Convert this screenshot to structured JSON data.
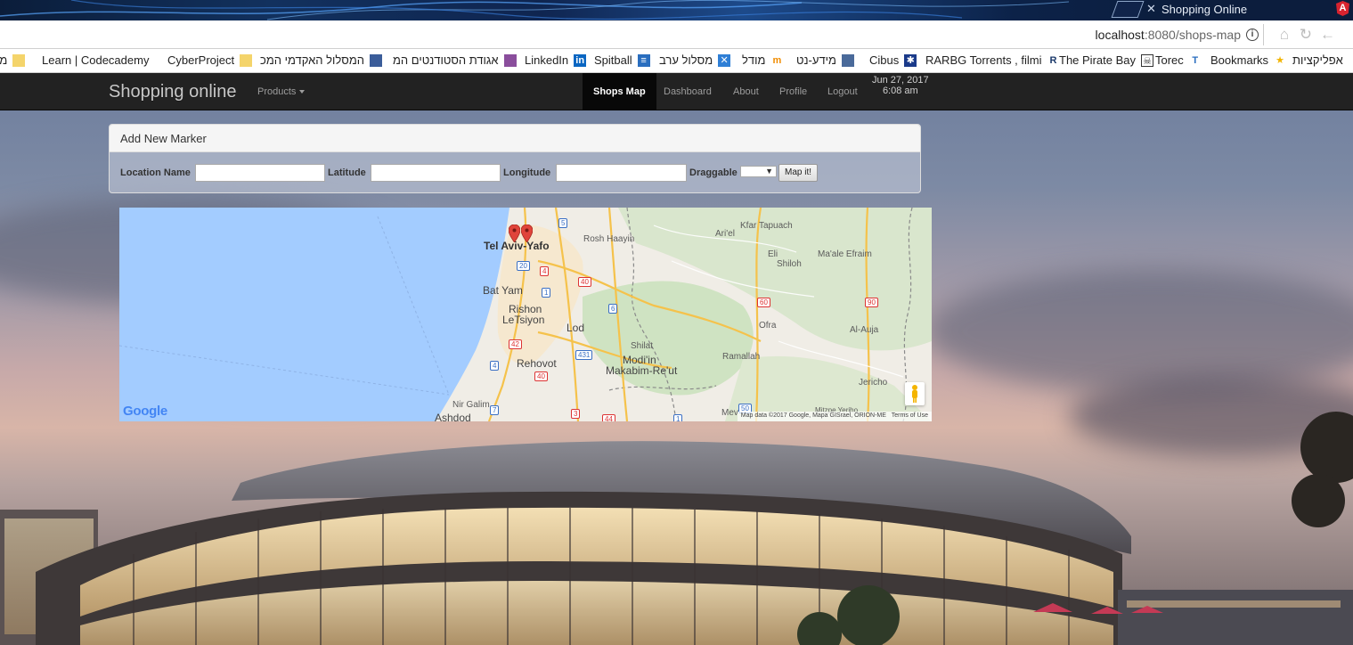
{
  "browser": {
    "tab_title": "Shopping Online",
    "url_host": "localhost",
    "url_rest": ":8080/shops-map",
    "bookmarks": [
      {
        "label": "מו",
        "icon": "bookmark-icon"
      },
      {
        "label": "Learn | Codecademy",
        "icon": "folder-icon"
      },
      {
        "label": "CyberProject",
        "icon": "folder-icon"
      },
      {
        "label": "המסלול האקדמי המכ",
        "icon": "page-icon"
      },
      {
        "label": "אגודת הסטודנטים המ",
        "icon": "page-icon"
      },
      {
        "label": "LinkedIn",
        "icon": "linkedin-icon"
      },
      {
        "label": "Spitball",
        "icon": "spitball-icon"
      },
      {
        "label": "מסלול ערב",
        "icon": "x-icon"
      },
      {
        "label": "מודל",
        "icon": "moodle-icon"
      },
      {
        "label": "מידע-נט",
        "icon": "page-icon"
      },
      {
        "label": "Cibus",
        "icon": "cibus-icon"
      },
      {
        "label": "RARBG Torrents , filmi",
        "icon": "rarbg-icon"
      },
      {
        "label": "The Pirate Bay",
        "icon": "piratebay-icon"
      },
      {
        "label": "Torec",
        "icon": "torec-icon"
      },
      {
        "label": "Bookmarks",
        "icon": "star-icon"
      },
      {
        "label": "אפליקציות",
        "icon": "apps-icon"
      }
    ]
  },
  "navbar": {
    "brand": "Shopping online",
    "products": "Products",
    "links": [
      "Shops Map",
      "Dashboard",
      "About",
      "Profile",
      "Logout"
    ],
    "active": "Shops Map",
    "date": "Jun 27, 2017",
    "time": "6:08 am"
  },
  "panel": {
    "heading": "Add New Marker",
    "location_label": "Location Name",
    "latitude_label": "Latitude",
    "longitude_label": "Longitude",
    "draggable_label": "Draggable",
    "location_value": "",
    "latitude_value": "",
    "longitude_value": "",
    "draggable_value": "",
    "button": "Map it!"
  },
  "map": {
    "places": {
      "tel_aviv": "Tel Aviv-Yafo",
      "rosh_haayin": "Rosh Haayin",
      "kfar_tapuach": "Kfar Tapuach",
      "ariel": "Ari'el",
      "eli": "Eli",
      "maale_efraim": "Ma'ale Efraim",
      "shiloh": "Shiloh",
      "bat_yam": "Bat Yam",
      "rishon": "Rishon",
      "letsiyon": "LeTsiyon",
      "lod": "Lod",
      "ofra": "Ofra",
      "al_auja": "Al-Auja",
      "shilat": "Shilat",
      "modiin": "Modi'in",
      "makabim": "Makabim-Re'ut",
      "ramallah": "Ramallah",
      "rehovot": "Rehovot",
      "jericho": "Jericho",
      "nir_galim": "Nir Galim",
      "ashdod": "Ashdod",
      "mevo": "Mev",
      "mitzpe": "Mitzpe Yeriho"
    },
    "routes": [
      "5",
      "20",
      "4",
      "40",
      "1",
      "6",
      "42",
      "431",
      "4",
      "40",
      "60",
      "90",
      "7",
      "3",
      "50",
      "44",
      "1"
    ],
    "google_logo": "Google",
    "attribution": "Map data ©2017 Google, Mapa GISrael, ORION-ME",
    "terms": "Terms of Use",
    "markers": 2
  }
}
